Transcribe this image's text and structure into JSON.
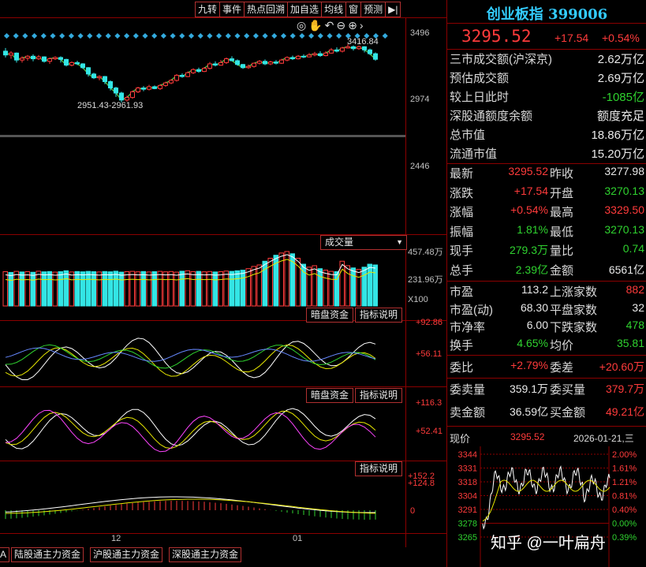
{
  "toolbar": [
    "九转",
    "事件",
    "热点回溯",
    "加自选",
    "均线",
    "窗",
    "预测",
    "▶|"
  ],
  "kline": {
    "y_labels": [
      "3496",
      "2974",
      "2446"
    ],
    "high_label": "3416.84",
    "low_label": "2951.43-2961.93",
    "candles": [
      [
        3360,
        3330,
        3385,
        3310
      ],
      [
        3330,
        3345,
        3360,
        3300
      ],
      [
        3345,
        3290,
        3350,
        3270
      ],
      [
        3290,
        3305,
        3320,
        3270
      ],
      [
        3305,
        3320,
        3330,
        3285
      ],
      [
        3320,
        3300,
        3335,
        3280
      ],
      [
        3300,
        3315,
        3330,
        3290
      ],
      [
        3315,
        3280,
        3320,
        3270
      ],
      [
        3280,
        3300,
        3310,
        3260
      ],
      [
        3300,
        3310,
        3320,
        3290
      ],
      [
        3310,
        3295,
        3320,
        3270
      ],
      [
        3295,
        3250,
        3300,
        3240
      ],
      [
        3250,
        3270,
        3280,
        3240
      ],
      [
        3270,
        3260,
        3285,
        3250
      ],
      [
        3260,
        3230,
        3265,
        3220
      ],
      [
        3230,
        3180,
        3235,
        3160
      ],
      [
        3180,
        3150,
        3190,
        3140
      ],
      [
        3150,
        3160,
        3170,
        3130
      ],
      [
        3160,
        3120,
        3165,
        3100
      ],
      [
        3120,
        3070,
        3130,
        3050
      ],
      [
        3070,
        3030,
        3080,
        3000
      ],
      [
        3030,
        2975,
        3040,
        2955
      ],
      [
        2975,
        2995,
        3010,
        2960
      ],
      [
        2995,
        3040,
        3050,
        2985
      ],
      [
        3040,
        3070,
        3080,
        3030
      ],
      [
        3070,
        3060,
        3085,
        3045
      ],
      [
        3060,
        3080,
        3095,
        3050
      ],
      [
        3080,
        3065,
        3090,
        3060
      ],
      [
        3065,
        3090,
        3100,
        3055
      ],
      [
        3090,
        3110,
        3120,
        3080
      ],
      [
        3110,
        3130,
        3140,
        3100
      ],
      [
        3130,
        3170,
        3180,
        3120
      ],
      [
        3170,
        3160,
        3185,
        3150
      ],
      [
        3160,
        3190,
        3200,
        3155
      ],
      [
        3190,
        3215,
        3225,
        3180
      ],
      [
        3215,
        3200,
        3230,
        3190
      ],
      [
        3200,
        3225,
        3235,
        3195
      ],
      [
        3225,
        3260,
        3275,
        3215
      ],
      [
        3260,
        3250,
        3280,
        3240
      ],
      [
        3250,
        3270,
        3290,
        3245
      ],
      [
        3270,
        3300,
        3310,
        3260
      ],
      [
        3300,
        3285,
        3320,
        3280
      ],
      [
        3285,
        3255,
        3295,
        3245
      ],
      [
        3255,
        3230,
        3260,
        3220
      ],
      [
        3230,
        3240,
        3255,
        3220
      ],
      [
        3240,
        3265,
        3270,
        3230
      ],
      [
        3265,
        3280,
        3290,
        3255
      ],
      [
        3280,
        3260,
        3295,
        3250
      ],
      [
        3260,
        3275,
        3285,
        3250
      ],
      [
        3275,
        3265,
        3290,
        3255
      ],
      [
        3265,
        3290,
        3300,
        3260
      ],
      [
        3290,
        3310,
        3320,
        3280
      ],
      [
        3310,
        3300,
        3325,
        3290
      ],
      [
        3300,
        3320,
        3330,
        3295
      ],
      [
        3320,
        3315,
        3335,
        3305
      ],
      [
        3315,
        3330,
        3345,
        3310
      ],
      [
        3330,
        3340,
        3355,
        3320
      ],
      [
        3340,
        3325,
        3360,
        3315
      ],
      [
        3325,
        3345,
        3360,
        3320
      ],
      [
        3345,
        3370,
        3385,
        3340
      ],
      [
        3370,
        3360,
        3390,
        3350
      ],
      [
        3360,
        3385,
        3395,
        3350
      ],
      [
        3385,
        3395,
        3417,
        3380
      ],
      [
        3395,
        3380,
        3405,
        3365
      ],
      [
        3380,
        3395,
        3405,
        3370
      ],
      [
        3395,
        3370,
        3400,
        3350
      ],
      [
        3370,
        3340,
        3380,
        3330
      ],
      [
        3340,
        3296,
        3350,
        3285
      ]
    ]
  },
  "volume": {
    "tag": "成交量",
    "y_labels": [
      "457.48万",
      "231.96万",
      "X100"
    ],
    "bars": [
      230,
      225,
      232,
      228,
      230,
      226,
      233,
      229,
      231,
      227,
      230,
      236,
      228,
      231,
      229,
      232,
      230,
      228,
      231,
      229,
      233,
      227,
      230,
      232,
      229,
      231,
      228,
      230,
      232,
      229,
      231,
      227,
      233,
      236,
      230,
      232,
      229,
      231,
      228,
      230,
      234,
      232,
      236,
      240,
      250,
      265,
      275,
      300,
      320,
      340,
      355,
      365,
      350,
      320,
      280,
      260,
      270,
      250,
      240,
      232,
      230,
      300,
      270,
      255,
      245,
      260,
      280,
      275
    ],
    "up": [
      1,
      0,
      1,
      0,
      1,
      0,
      1,
      0,
      0,
      1,
      0,
      0,
      1,
      0,
      0,
      0,
      0,
      1,
      0,
      0,
      0,
      0,
      1,
      1,
      1,
      0,
      1,
      0,
      1,
      1,
      1,
      1,
      0,
      1,
      1,
      0,
      1,
      1,
      0,
      1,
      1,
      0,
      0,
      0,
      1,
      1,
      1,
      0,
      1,
      0,
      1,
      1,
      0,
      1,
      0,
      1,
      1,
      0,
      1,
      1,
      0,
      1,
      1,
      0,
      1,
      0,
      0,
      0
    ]
  },
  "panel_tags": {
    "dark": "暗盘资金",
    "explain": "指标说明"
  },
  "ind1": {
    "y_labels": [
      "+92.86",
      "+56.11"
    ]
  },
  "ind2": {
    "y_labels": [
      "+116.3",
      "+52.41"
    ]
  },
  "ind3": {
    "y_labels": [
      "+152.2",
      "+124.8",
      "0"
    ]
  },
  "x_labels": [
    "12",
    "01"
  ],
  "bottom_tabs": [
    "A",
    "陆股通主力资金",
    "沪股通主力资金",
    "深股通主力资金"
  ],
  "quote": {
    "title": "创业板指 399006",
    "price": "3295.52",
    "change": "+17.54",
    "change_pct": "+0.54%",
    "rows": [
      [
        "三市成交额(沪深京)",
        "2.62万亿",
        "w"
      ],
      [
        "预估成交额",
        "2.69万亿",
        "w"
      ],
      [
        "较上日此时",
        "-1085亿",
        "g"
      ],
      [
        "深股通额度余额",
        "额度充足",
        "w"
      ],
      [
        "总市值",
        "18.86万亿",
        "w"
      ],
      [
        "流通市值",
        "15.20万亿",
        "w"
      ]
    ],
    "grid1": [
      [
        "最新",
        "3295.52",
        "r1",
        "昨收",
        "3277.98",
        "w"
      ],
      [
        "涨跌",
        "+17.54",
        "r1",
        "开盘",
        "3270.13",
        "g"
      ],
      [
        "涨幅",
        "+0.54%",
        "r1",
        "最高",
        "3329.50",
        "r1"
      ],
      [
        "振幅",
        "1.81%",
        "g",
        "最低",
        "3270.13",
        "g"
      ],
      [
        "现手",
        "279.3万",
        "g",
        "量比",
        "0.74",
        "g"
      ],
      [
        "总手",
        "2.39亿",
        "g",
        "金额",
        "6561亿",
        "w"
      ]
    ],
    "grid2": [
      [
        "市盈",
        "113.2",
        "w",
        "上涨家数",
        "882",
        "r1"
      ],
      [
        "市盈(动)",
        "68.30",
        "w",
        "平盘家数",
        "32",
        "w"
      ],
      [
        "市净率",
        "6.00",
        "w",
        "下跌家数",
        "478",
        "g"
      ],
      [
        "换手",
        "4.65%",
        "g",
        "均价",
        "35.81",
        "g"
      ]
    ],
    "grid3": [
      [
        "委比",
        "+2.79%",
        "r1",
        "委差",
        "+20.60万",
        "r1"
      ]
    ],
    "grid4": [
      [
        "委卖量",
        "359.1万",
        "w",
        "委买量",
        "379.7万",
        "r1"
      ],
      [
        "卖金额",
        "36.59亿",
        "w",
        "买金额",
        "49.21亿",
        "r1"
      ]
    ]
  },
  "mini": {
    "label": "现价",
    "price": "3295.52",
    "date": "2026-01-21,三",
    "left_labels": [
      "3344",
      "3331",
      "3318",
      "3304",
      "3291",
      "3278",
      "3265"
    ],
    "right_labels": [
      "2.00%",
      "1.61%",
      "1.21%",
      "0.81%",
      "0.40%",
      "0.00%",
      "0.39%"
    ],
    "watermark": "知乎 @一叶扁舟"
  },
  "colors": {
    "up": "#ff3b3b",
    "down": "#33e5e5",
    "grid": "#8b0000",
    "ma5": "#ffffff",
    "ma10": "#e8e800",
    "ma20": "#ff44ff",
    "ma60": "#2fd22f"
  }
}
